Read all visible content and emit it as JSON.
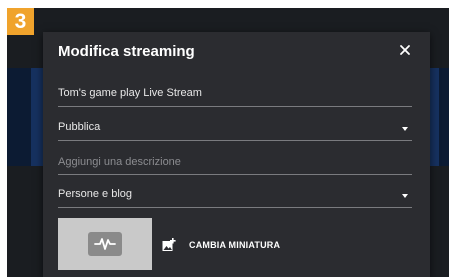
{
  "step": {
    "number": "3"
  },
  "dialog": {
    "title": "Modifica streaming",
    "close_icon": "close-icon"
  },
  "form": {
    "stream_title": {
      "value": "Tom's game play Live Stream"
    },
    "visibility": {
      "selected": "Pubblica",
      "icon": "dropdown-caret-icon"
    },
    "description": {
      "value": "",
      "placeholder": "Aggiungi una descrizione"
    },
    "category": {
      "selected": "Persone e blog",
      "icon": "dropdown-caret-icon"
    }
  },
  "thumbnail": {
    "preview_icon": "waveform-icon",
    "change_label": "CAMBIA MINIATURA",
    "change_icon": "add-image-icon"
  },
  "colors": {
    "badge": "#f0a32c",
    "dialog_bg": "#2b2c30",
    "backdrop": "#1a1d21",
    "text": "#ffffff",
    "placeholder": "#8b8c90"
  }
}
